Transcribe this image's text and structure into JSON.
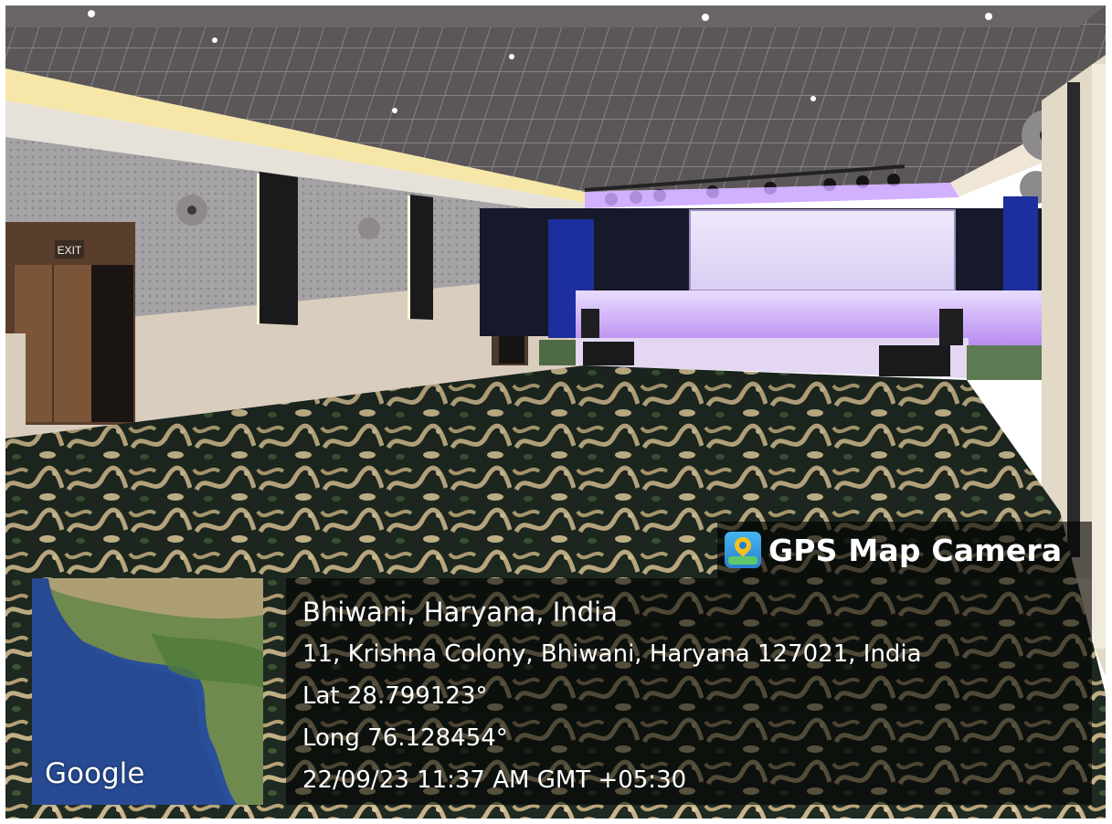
{
  "photo": {
    "exit_sign": "EXIT"
  },
  "overlay": {
    "app_name": "GPS Map Camera",
    "app_icon": "map-pin-icon",
    "place": "Bhiwani, Haryana, India",
    "address": "11, Krishna Colony, Bhiwani, Haryana 127021, India",
    "latitude": "Lat 28.799123°",
    "longitude": "Long 76.128454°",
    "timestamp": "22/09/23 11:37 AM GMT +05:30"
  },
  "map": {
    "attribution": "Google"
  },
  "colors": {
    "stage_glow": "#c7a3f5",
    "curtain": "#1d2f9e",
    "carpet_dark": "#1f2a22",
    "carpet_light": "#c8b58a",
    "ocean": "#2a4f9a",
    "land": "#6f8a4e"
  }
}
